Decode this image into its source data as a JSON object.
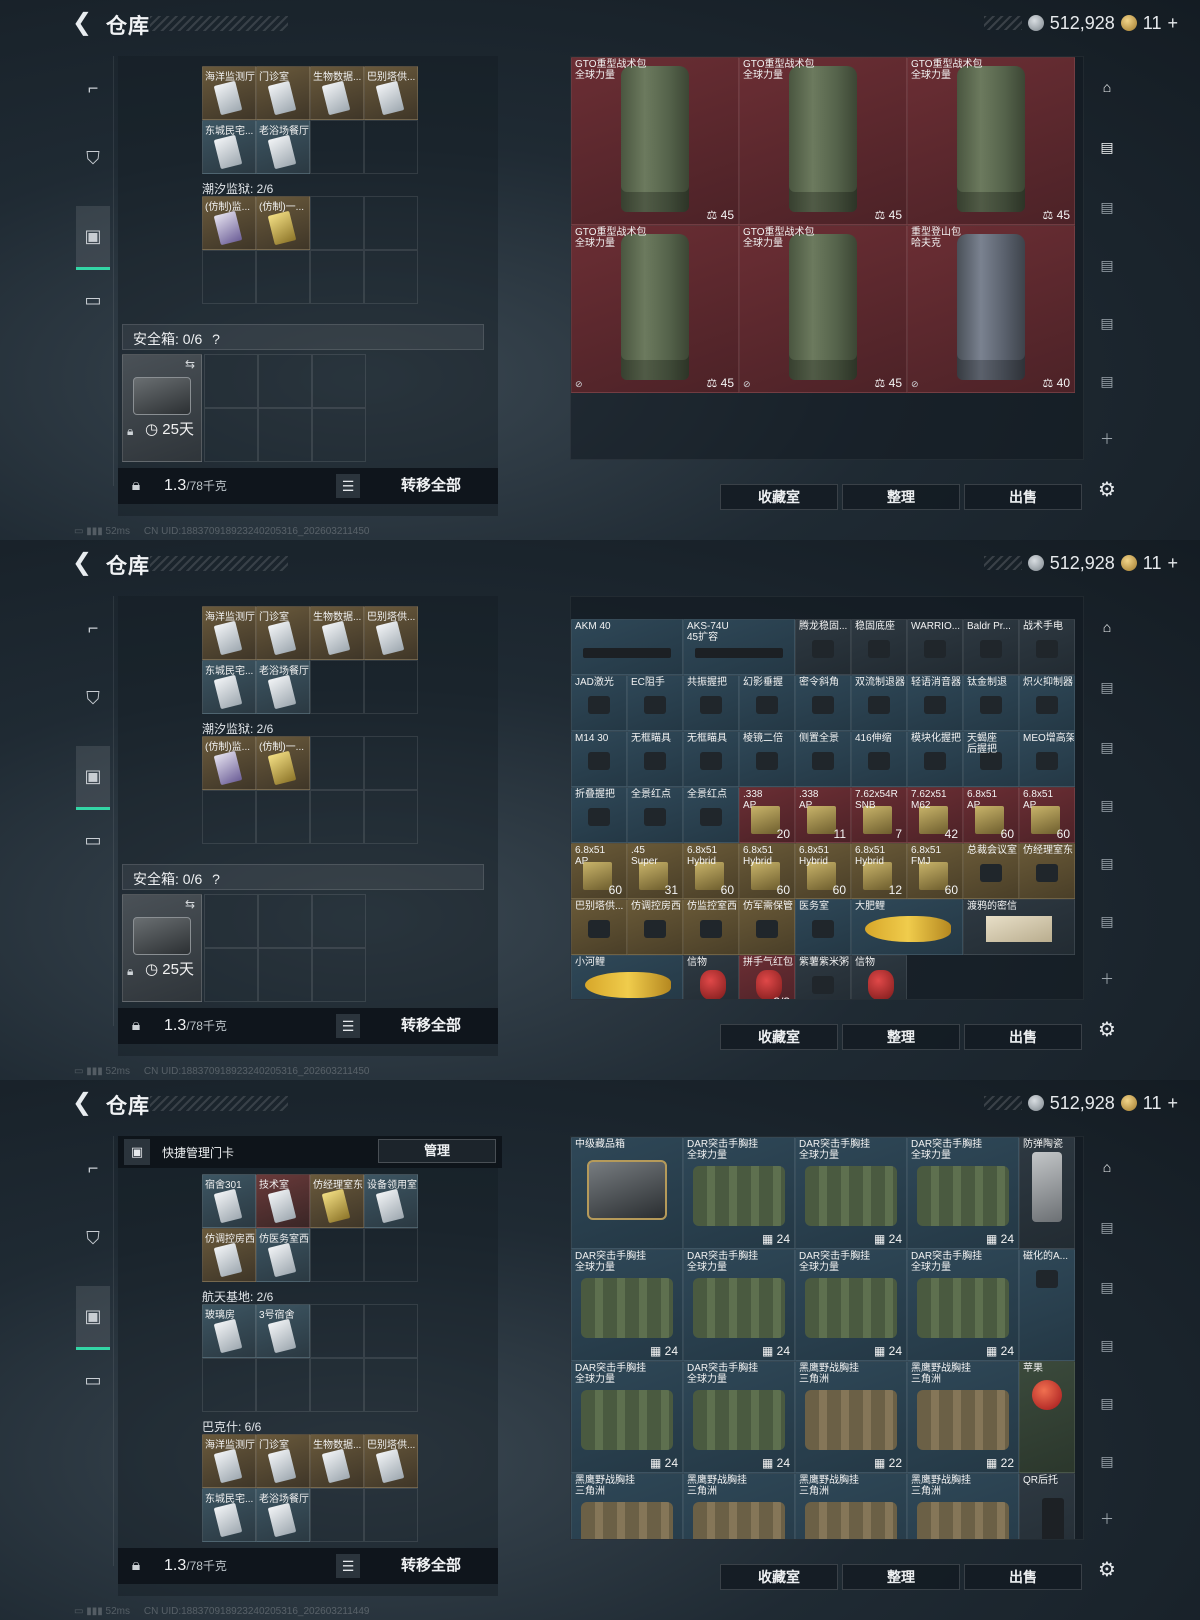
{
  "header": {
    "back_label": "❮",
    "title": "仓库",
    "currency_amount": "512,928",
    "premium_count": "11",
    "premium_plus": "+"
  },
  "sidebar": {
    "items": [
      {
        "name": "sidebar-item-weapons",
        "glyph": "⌐"
      },
      {
        "name": "sidebar-item-equipment",
        "glyph": "⛉"
      },
      {
        "name": "sidebar-item-backpack",
        "glyph": "▣"
      },
      {
        "name": "sidebar-item-toolbox",
        "glyph": "▭"
      }
    ]
  },
  "left": {
    "safe_label": "安全箱: 0/6",
    "safe_help": "?",
    "safe_days": "25天",
    "weight_value": "1.3",
    "weight_unit": "/78千克",
    "transfer_all": "转移全部",
    "quick_manage_label": "快捷管理门卡",
    "manage_button": "管理",
    "groups_shot1": [
      {
        "label": "",
        "cards": [
          {
            "name": "海洋监测厅",
            "tone": "gold"
          },
          {
            "name": "门诊室",
            "tone": "gold"
          },
          {
            "name": "生物数据...",
            "tone": "gold"
          },
          {
            "name": "巴别塔供...",
            "tone": "gold"
          },
          {
            "name": "东城民宅...",
            "tone": "blue"
          },
          {
            "name": "老浴场餐厅",
            "tone": "blue"
          }
        ]
      },
      {
        "label": "潮汐监狱: 2/6",
        "cards": [
          {
            "name": "(仿制)监...",
            "tone": "gold",
            "key": "purple"
          },
          {
            "name": "(仿制)一...",
            "tone": "gold",
            "key": "gold"
          }
        ]
      }
    ],
    "groups_shot3": [
      {
        "label": "",
        "cards": [
          {
            "name": "宿舍301",
            "tone": "blue"
          },
          {
            "name": "技术室",
            "tone": "red"
          },
          {
            "name": "仿经理室东",
            "tone": "gold",
            "key": "gold"
          },
          {
            "name": "设备领用室",
            "tone": "blue"
          },
          {
            "name": "仿调控房西",
            "tone": "gold"
          },
          {
            "name": "仿医务室西",
            "tone": "blue"
          }
        ]
      },
      {
        "label": "航天基地: 2/6",
        "cards": [
          {
            "name": "玻璃房",
            "tone": "blue"
          },
          {
            "name": "3号宿舍",
            "tone": "blue"
          }
        ]
      },
      {
        "label": "巴克什: 6/6",
        "cards": [
          {
            "name": "海洋监测厅",
            "tone": "gold"
          },
          {
            "name": "门诊室",
            "tone": "gold"
          },
          {
            "name": "生物数据...",
            "tone": "gold"
          },
          {
            "name": "巴别塔供...",
            "tone": "gold"
          },
          {
            "name": "东城民宅...",
            "tone": "blue"
          },
          {
            "name": "老浴场餐厅",
            "tone": "blue"
          }
        ]
      }
    ]
  },
  "right": {
    "actions": [
      "收藏室",
      "整理",
      "出售"
    ],
    "shot1_items": [
      {
        "name": "GTO重型战术包\n全球力量",
        "cap": "45",
        "art": "backpack"
      },
      {
        "name": "GTO重型战术包\n全球力量",
        "cap": "45",
        "art": "backpack"
      },
      {
        "name": "GTO重型战术包\n全球力量",
        "cap": "45",
        "art": "backpack"
      },
      {
        "name": "GTO重型战术包\n全球力量",
        "cap": "45",
        "art": "backpack"
      },
      {
        "name": "GTO重型战术包\n全球力量",
        "cap": "45",
        "art": "backpack"
      },
      {
        "name": "重型登山包\n哈夫克",
        "cap": "40",
        "art": "backpack-grey"
      }
    ],
    "shot2_rows": [
      [
        {
          "name": "AKM 40",
          "bg": "blue",
          "art": "gun",
          "span": 2
        },
        {
          "name": "AKS-74U\n45扩容",
          "bg": "blue",
          "art": "gun",
          "span": 2
        },
        {
          "name": "腾龙稳固...",
          "bg": "dark",
          "art": "part"
        },
        {
          "name": "稳固底座",
          "bg": "dark",
          "art": "part"
        },
        {
          "name": "WARRIO...",
          "bg": "dark",
          "art": "part"
        },
        {
          "name": "Baldr Pr...",
          "bg": "dark",
          "art": "part"
        },
        {
          "name": "战术手电",
          "bg": "dark",
          "art": "part"
        }
      ],
      [
        {
          "name": "JAD激光",
          "bg": "blue",
          "art": "part"
        },
        {
          "name": "EC阻手",
          "bg": "blue",
          "art": "part"
        },
        {
          "name": "共振握把",
          "bg": "blue",
          "art": "part"
        },
        {
          "name": "幻影垂握",
          "bg": "blue",
          "art": "part"
        },
        {
          "name": "密令斜角",
          "bg": "blue",
          "art": "part"
        },
        {
          "name": "双流制退器",
          "bg": "blue",
          "art": "part"
        },
        {
          "name": "轻语消音器",
          "bg": "blue",
          "art": "part"
        },
        {
          "name": "钛金制退",
          "bg": "blue",
          "art": "part"
        },
        {
          "name": "炽火抑制器",
          "bg": "blue",
          "art": "part"
        }
      ],
      [
        {
          "name": "M14 30",
          "bg": "blue",
          "art": "part"
        },
        {
          "name": "无框瞄具",
          "bg": "blue",
          "art": "part"
        },
        {
          "name": "无框瞄具",
          "bg": "blue",
          "art": "part"
        },
        {
          "name": "棱镜二倍",
          "bg": "blue",
          "art": "part"
        },
        {
          "name": "侧置全景",
          "bg": "blue",
          "art": "part"
        },
        {
          "name": "416伸缩",
          "bg": "blue",
          "art": "part"
        },
        {
          "name": "模块化握把",
          "bg": "blue",
          "art": "part"
        },
        {
          "name": "天蝎座\n后握把",
          "bg": "blue",
          "art": "part"
        },
        {
          "name": "MEO增高架",
          "bg": "blue",
          "art": "part"
        }
      ],
      [
        {
          "name": "折叠握把",
          "bg": "blue",
          "art": "part"
        },
        {
          "name": "全景红点",
          "bg": "blue",
          "art": "part"
        },
        {
          "name": "全景红点",
          "bg": "blue",
          "art": "part"
        },
        {
          "name": ".338\nAP",
          "bg": "red",
          "art": "ammo",
          "qty": "20"
        },
        {
          "name": ".338\nAP",
          "bg": "red",
          "art": "ammo",
          "qty": "11"
        },
        {
          "name": "7.62x54R\nSNB",
          "bg": "red",
          "art": "ammo",
          "qty": "7"
        },
        {
          "name": "7.62x51\nM62",
          "bg": "red",
          "art": "ammo",
          "qty": "42"
        },
        {
          "name": "6.8x51\nAP",
          "bg": "red",
          "art": "ammo",
          "qty": "60"
        },
        {
          "name": "6.8x51\nAP",
          "bg": "red",
          "art": "ammo",
          "qty": "60"
        }
      ],
      [
        {
          "name": "6.8x51\nAP",
          "bg": "gold",
          "art": "ammo",
          "qty": "60"
        },
        {
          "name": ".45\nSuper",
          "bg": "gold",
          "art": "ammo",
          "qty": "31"
        },
        {
          "name": "6.8x51\nHybrid",
          "bg": "gold",
          "art": "ammo",
          "qty": "60"
        },
        {
          "name": "6.8x51\nHybrid",
          "bg": "gold",
          "art": "ammo",
          "qty": "60"
        },
        {
          "name": "6.8x51\nHybrid",
          "bg": "gold",
          "art": "ammo",
          "qty": "60"
        },
        {
          "name": "6.8x51\nHybrid",
          "bg": "gold",
          "art": "ammo",
          "qty": "12"
        },
        {
          "name": "6.8x51\nFMJ",
          "bg": "gold",
          "art": "ammo",
          "qty": "60"
        },
        {
          "name": "总裁会议室",
          "bg": "gold",
          "art": "card"
        },
        {
          "name": "仿经理室东",
          "bg": "gold",
          "art": "card"
        }
      ],
      [
        {
          "name": "巴别塔供...",
          "bg": "gold",
          "art": "card"
        },
        {
          "name": "仿调控房西",
          "bg": "gold",
          "art": "card"
        },
        {
          "name": "仿监控室西",
          "bg": "gold",
          "art": "card"
        },
        {
          "name": "仿军需保管",
          "bg": "gold",
          "art": "card"
        },
        {
          "name": "医务室",
          "bg": "blue",
          "art": "card"
        },
        {
          "name": "大肥鲤",
          "bg": "blue",
          "art": "fish",
          "span": 2
        },
        {
          "name": "渡鸦的密信",
          "bg": "dark",
          "art": "note",
          "span": 2
        }
      ],
      [
        {
          "name": "小河鲤",
          "bg": "blue",
          "art": "fish",
          "span": 2
        },
        {
          "name": "信物",
          "bg": "dark",
          "art": "mask"
        },
        {
          "name": "拼手气红包",
          "bg": "red",
          "art": "mask",
          "qty": "3/3"
        },
        {
          "name": "紫薯紫米粥",
          "bg": "dark",
          "art": "part"
        },
        {
          "name": "信物",
          "bg": "dark",
          "art": "mask"
        }
      ]
    ],
    "shot3_rows": [
      [
        {
          "name": "中级藏品箱",
          "bg": "blue",
          "art": "vault"
        },
        {
          "name": "DAR突击手胸挂\n全球力量",
          "bg": "blue",
          "art": "rig",
          "cap": "24"
        },
        {
          "name": "DAR突击手胸挂\n全球力量",
          "bg": "blue",
          "art": "rig",
          "cap": "24"
        },
        {
          "name": "DAR突击手胸挂\n全球力量",
          "bg": "blue",
          "art": "rig",
          "cap": "24"
        },
        {
          "name": "防弹陶瓷",
          "bg": "dark",
          "art": "plate"
        }
      ],
      [
        {
          "name": "DAR突击手胸挂\n全球力量",
          "bg": "blue",
          "art": "rig",
          "cap": "24"
        },
        {
          "name": "DAR突击手胸挂\n全球力量",
          "bg": "blue",
          "art": "rig",
          "cap": "24"
        },
        {
          "name": "DAR突击手胸挂\n全球力量",
          "bg": "blue",
          "art": "rig",
          "cap": "24"
        },
        {
          "name": "DAR突击手胸挂\n全球力量",
          "bg": "blue",
          "art": "rig",
          "cap": "24"
        },
        {
          "name": "磁化的A...",
          "bg": "blue",
          "art": "card"
        }
      ],
      [
        {
          "name": "DAR突击手胸挂\n全球力量",
          "bg": "blue",
          "art": "rig",
          "cap": "24"
        },
        {
          "name": "DAR突击手胸挂\n全球力量",
          "bg": "blue",
          "art": "rig",
          "cap": "24"
        },
        {
          "name": "黑鹰野战胸挂\n三角洲",
          "bg": "blue",
          "art": "rig-tan",
          "cap": "22"
        },
        {
          "name": "黑鹰野战胸挂\n三角洲",
          "bg": "blue",
          "art": "rig-tan",
          "cap": "22"
        },
        {
          "name": "苹果",
          "bg": "green",
          "art": "apple"
        }
      ],
      [
        {
          "name": "黑鹰野战胸挂\n三角洲",
          "bg": "blue",
          "art": "rig-tan"
        },
        {
          "name": "黑鹰野战胸挂\n三角洲",
          "bg": "blue",
          "art": "rig-tan"
        },
        {
          "name": "黑鹰野战胸挂\n三角洲",
          "bg": "blue",
          "art": "rig-tan"
        },
        {
          "name": "黑鹰野战胸挂\n三角洲",
          "bg": "blue",
          "art": "rig-tan"
        },
        {
          "name": "QR后托",
          "bg": "dark",
          "art": "stock"
        }
      ]
    ]
  },
  "footer": {
    "ping": "52ms",
    "uid_shot1": "CN UID:1883709189232402053​16_202603211450",
    "uid_shot3": "CN UID:1883709189232402053​16_202603211449"
  },
  "colors": {
    "accent": "#33d6a6",
    "gold_card": "#6a5a38",
    "red_item": "#6b2e34",
    "blue_item": "#2f4858"
  }
}
